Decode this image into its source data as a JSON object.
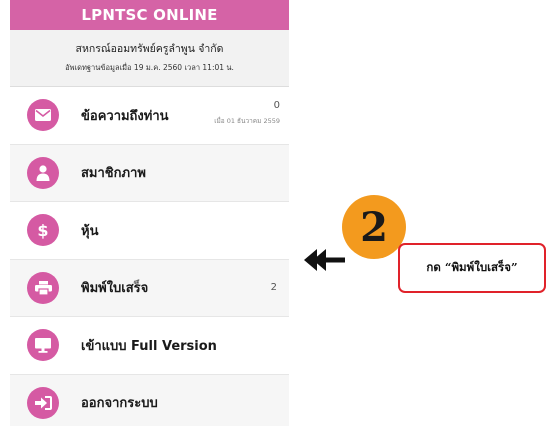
{
  "app": {
    "title": "LPNTSC ONLINE",
    "org_name": "สหกรณ์ออมทรัพย์ครูลำพูน จำกัด",
    "updated": "อัพเดทฐานข้อมูลเมื่อ 19 ม.ค. 2560 เวลา 11:01 น."
  },
  "menu": {
    "messages": {
      "label": "ข้อความถึงท่าน",
      "count": "0",
      "date": "เมื่อ 01 ธันวาคม 2559",
      "icon": "envelope-icon"
    },
    "member": {
      "label": "สมาชิกภาพ",
      "icon": "person-icon"
    },
    "shares": {
      "label": "หุ้น",
      "icon": "dollar-icon"
    },
    "receipt": {
      "label": "พิมพ์ใบเสร็จ",
      "count": "2",
      "icon": "printer-icon"
    },
    "full_version": {
      "label": "เข้าแบบ Full Version",
      "icon": "monitor-icon"
    },
    "logout": {
      "label": "ออกจากระบบ",
      "icon": "sign-out-icon"
    }
  },
  "annotation": {
    "step_number": "2",
    "callout_text": "กด “พิมพ์ใบเสร็จ”",
    "arrow_icon": "double-left-arrow-icon"
  },
  "colors": {
    "accent": "#d563a6",
    "step_badge": "#f39a1e",
    "callout_border": "#e0222a"
  }
}
